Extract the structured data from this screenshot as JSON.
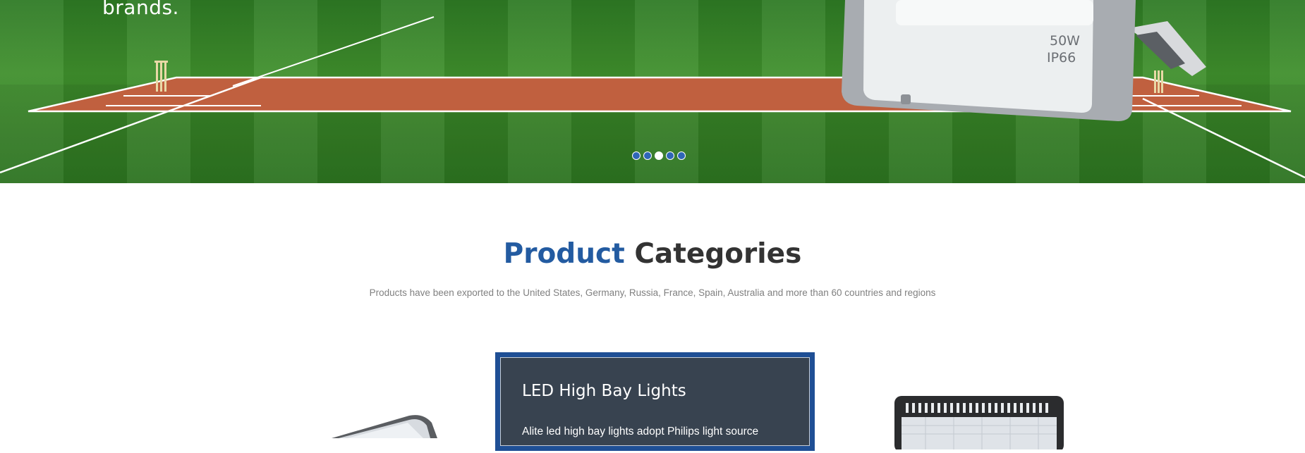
{
  "hero": {
    "text": "brands.",
    "fixture_label_line1": "50W",
    "fixture_label_line2": "IP66",
    "slides": [
      {
        "active": false
      },
      {
        "active": false
      },
      {
        "active": true
      },
      {
        "active": false
      },
      {
        "active": false
      }
    ]
  },
  "categories": {
    "title_accent": "Product",
    "title_rest": "Categories",
    "subtitle": "Products have been exported to the United States, Germany, Russia, France, Spain, Australia and more than 60 countries and regions",
    "featured": {
      "title": "LED High Bay Lights",
      "description": "Alite led high bay lights adopt Philips light source"
    }
  },
  "colors": {
    "accent": "#235ba1",
    "card_border": "#1f4f95",
    "card_bg": "#384350",
    "dot": "#2f66b7"
  }
}
